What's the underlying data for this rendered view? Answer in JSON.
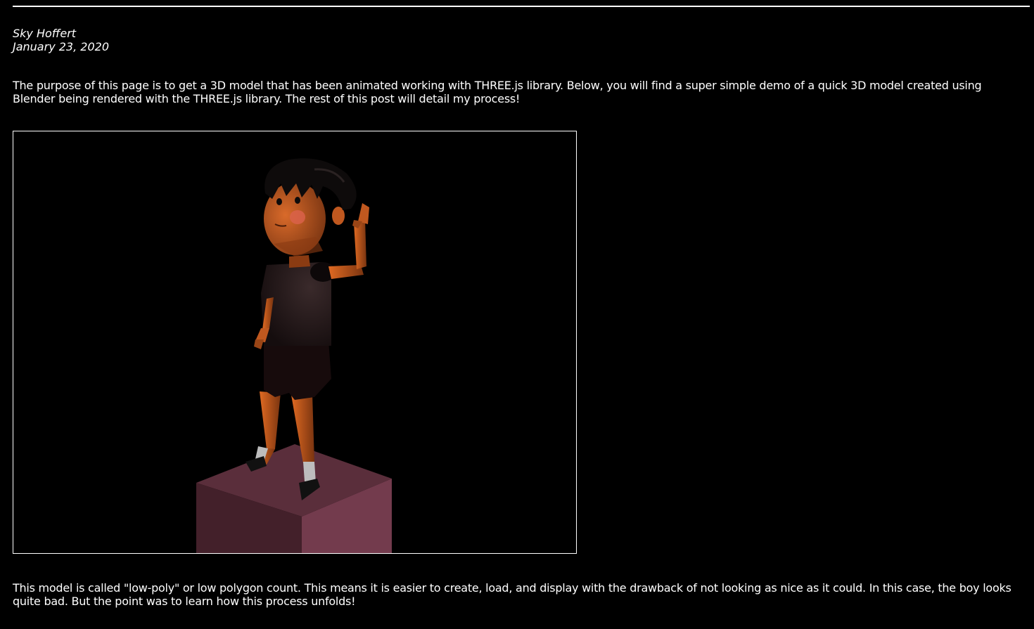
{
  "post": {
    "author": "Sky Hoffert",
    "date": "January 23, 2020",
    "intro": "The purpose of this page is to get a 3D model that has been animated working with THREE.js library. Below, you will find a super simple demo of a quick 3D model created using Blender being rendered with the THREE.js library. The rest of this post will detail my process!",
    "outro": "This model is called \"low-poly\" or low polygon count. This means it is easier to create, load, and display with the drawback of not looking as nice as it could. In this case, the boy looks quite bad. But the point was to learn how this process unfolds!"
  },
  "scene": {
    "background": "#000000",
    "pedestal_top": "#5a2e3b",
    "pedestal_left": "#43202a",
    "pedestal_right": "#733b4d",
    "skin": "#c0581f",
    "shirt": "#1d1415",
    "shorts": "#170b0c",
    "hair": "#0e0b0b",
    "socks": "#bdbdbd",
    "shoes": "#111111",
    "cheek": "#d9614a"
  }
}
